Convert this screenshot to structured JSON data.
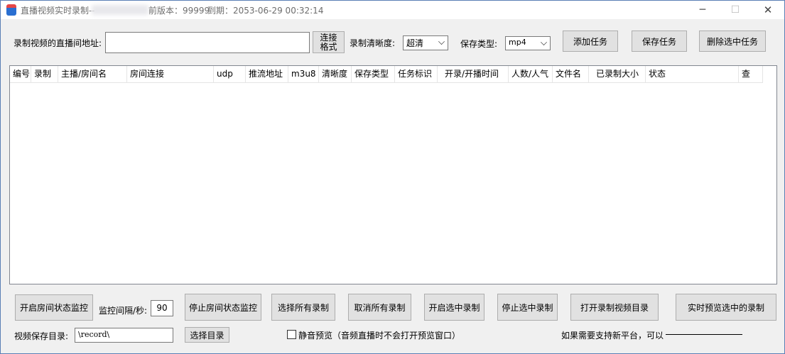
{
  "titlebar": {
    "title": "直播视频实时录制--",
    "version": "前版本：99999",
    "expire": "到期：2053-06-29 00:32:14",
    "min_icon": "─",
    "max_icon": "☐",
    "close_icon": "✕"
  },
  "top": {
    "url_label": "录制视频的直播间地址:",
    "url_value": "",
    "connect_format_line1": "连接",
    "connect_format_line2": "格式",
    "quality_label": "录制清晰度:",
    "quality_value": "超清",
    "save_type_label": "保存类型:",
    "save_type_value": "mp4",
    "add_task": "添加任务",
    "save_task": "保存任务",
    "delete_selected": "删除选中任务"
  },
  "table": {
    "columns": [
      "编号",
      "录制",
      "主播/房间名",
      "房间连接",
      "udp",
      "推流地址",
      "m3u8",
      "清晰度",
      "保存类型",
      "任务标识",
      "开录/开播时间",
      "人数/人气",
      "文件名",
      "已录制大小",
      "状态",
      "查"
    ],
    "rows": []
  },
  "bottom": {
    "start_monitor": "开启房间状态监控",
    "interval_label": "监控间隔/秒:",
    "interval_value": "90",
    "stop_monitor": "停止房间状态监控",
    "select_all": "选择所有录制",
    "cancel_all": "取消所有录制",
    "start_selected": "开启选中录制",
    "stop_selected": "停止选中录制",
    "open_dir": "打开录制视频目录",
    "preview_selected": "实时预览选中的录制",
    "save_dir_label": "视频保存目录:",
    "save_dir_value": "\\record\\",
    "choose_dir": "选择目录",
    "mute_preview": "静音预览（音频直播时不会打开预览窗口）",
    "new_platform": "如果需要支持新平台，可以"
  }
}
